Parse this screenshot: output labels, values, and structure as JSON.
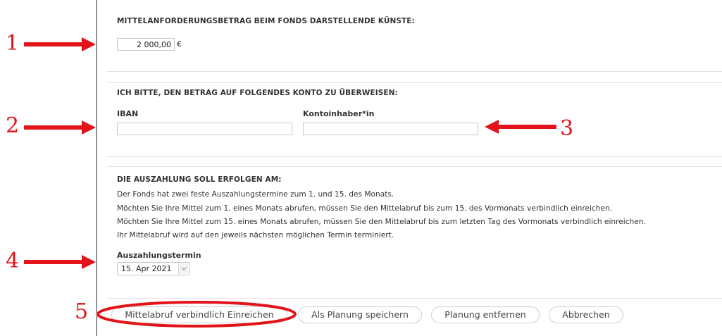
{
  "funding_section": {
    "heading": "MITTELANFORDERUNGSBETRAG BEIM FONDS DARSTELLENDE KÜNSTE:",
    "amount_value": "2 000,00",
    "currency": "€"
  },
  "bank_section": {
    "heading": "ICH BITTE, DEN BETRAG AUF FOLGENDES KONTO ZU ÜBERWEISEN:",
    "iban_label": "IBAN",
    "iban_value": "",
    "holder_label": "Kontoinhaber*in",
    "holder_value": ""
  },
  "payout_section": {
    "heading": "DIE AUSZAHLUNG SOLL ERFOLGEN AM:",
    "info_lines": [
      "Der Fonds hat zwei feste Auszahlungstermine zum 1. und 15. des Monats.",
      "Möchten Sie Ihre Mittel zum 1. eines Monats abrufen, müssen Sie den Mittelabruf bis zum 15. des Vormonats verbindlich einreichen.",
      "Möchten Sie Ihre Mittel zum 15. eines Monats abrufen, müssen Sie den Mittelabruf bis zum letzten Tag des Vormonats verbindlich einreichen.",
      "Ihr Mittelabruf wird auf den jeweils nächsten möglichen Termin terminiert."
    ],
    "date_label": "Auszahlungstermin",
    "date_value": "15. Apr 2021"
  },
  "actions": {
    "submit": "Mittelabruf verbindlich Einreichen",
    "save_plan": "Als Planung speichern",
    "remove_plan": "Planung entfernen",
    "cancel": "Abbrechen"
  },
  "annotations": {
    "n1": "1",
    "n2": "2",
    "n3": "3",
    "n4": "4",
    "n5": "5"
  },
  "colors": {
    "annotation": "#e2141a",
    "border": "#c8c8c8"
  }
}
